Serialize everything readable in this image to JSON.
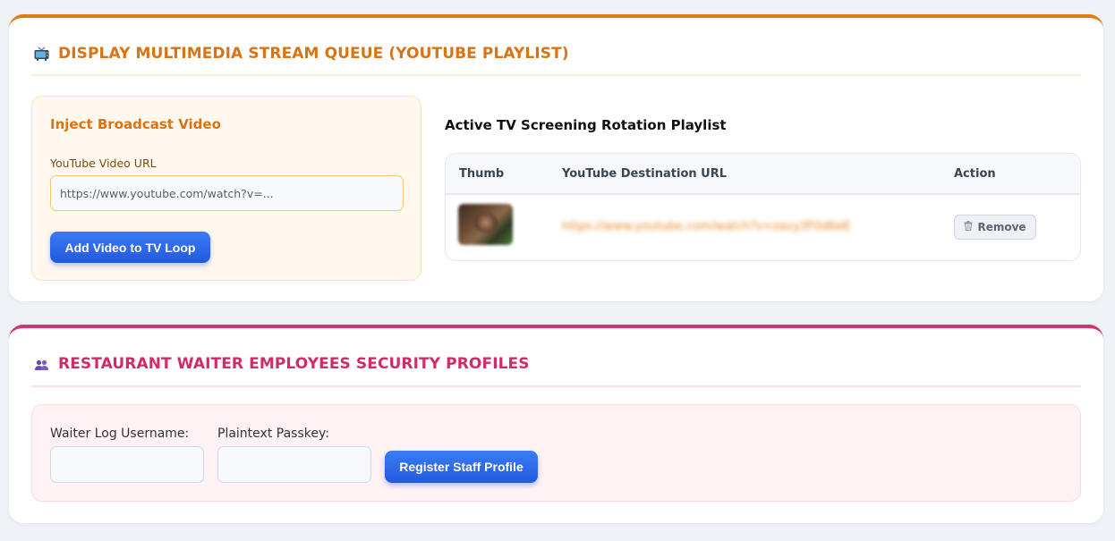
{
  "youtube_card": {
    "title": "DISPLAY MULTIMEDIA STREAM QUEUE (YOUTUBE PLAYLIST)",
    "icon": "tv-icon",
    "accent_color": "#e07b12",
    "inject": {
      "heading": "Inject Broadcast Video",
      "url_label": "YouTube Video URL",
      "url_value": "",
      "url_placeholder": "https://www.youtube.com/watch?v=...",
      "add_button": "Add Video to TV Loop"
    },
    "playlist": {
      "heading": "Active TV Screening Rotation Playlist",
      "columns": [
        "Thumb",
        "YouTube Destination URL",
        "Action"
      ],
      "rows": [
        {
          "url": "https://www.youtube.com/watch?v=zavy3F0d6eE",
          "action": "Remove"
        }
      ]
    }
  },
  "staff_card": {
    "title": "RESTAURANT WAITER EMPLOYEES SECURITY PROFILES",
    "icon": "users-icon",
    "accent_color": "#d6336c",
    "username_label": "Waiter Log Username:",
    "username_value": "",
    "passkey_label": "Plaintext Passkey:",
    "passkey_value": "",
    "register_button": "Register Staff Profile"
  }
}
